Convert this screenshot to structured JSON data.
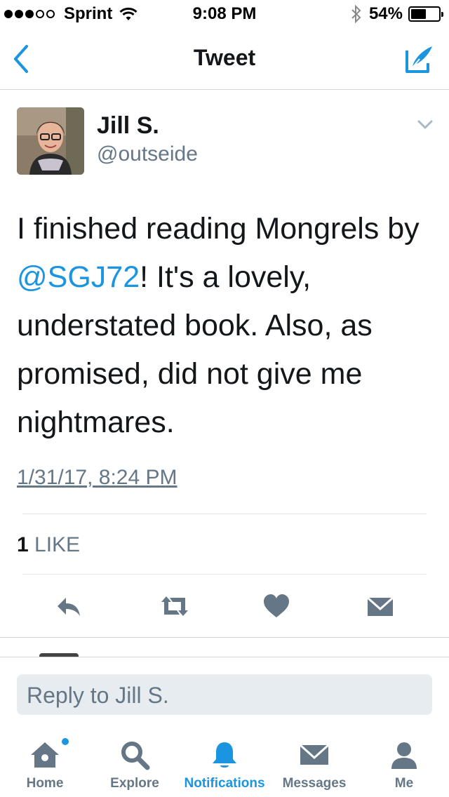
{
  "status_bar": {
    "signal_filled": 3,
    "signal_total": 5,
    "carrier": "Sprint",
    "time": "9:08 PM",
    "battery_percent": "54%",
    "battery_level": 0.54
  },
  "nav": {
    "title": "Tweet",
    "back_icon": "chevron-left-icon",
    "compose_icon": "compose-tweet-icon"
  },
  "tweet": {
    "author_name": "Jill S.",
    "author_handle": "@outseide",
    "text_before": "I finished reading Mongrels by ",
    "mention": "@SGJ72",
    "text_after": "! It's a lovely, understated book. Also, as promised, did not give me nightmares.",
    "timestamp": "1/31/17, 8:24 PM",
    "like_count": "1",
    "like_label": "LIKE"
  },
  "actions": [
    "reply-icon",
    "retweet-icon",
    "heart-icon",
    "direct-message-icon"
  ],
  "reply": {
    "placeholder": "Reply to Jill S."
  },
  "tabbar": {
    "items": [
      {
        "label": "Home",
        "icon": "home-icon"
      },
      {
        "label": "Explore",
        "icon": "search-icon"
      },
      {
        "label": "Notifications",
        "icon": "bell-icon"
      },
      {
        "label": "Messages",
        "icon": "envelope-icon"
      },
      {
        "label": "Me",
        "icon": "person-icon"
      }
    ],
    "active_index": 2
  },
  "colors": {
    "accent": "#1b95e0",
    "text": "#14171a",
    "muted": "#657786",
    "icon_gray": "#657786"
  }
}
